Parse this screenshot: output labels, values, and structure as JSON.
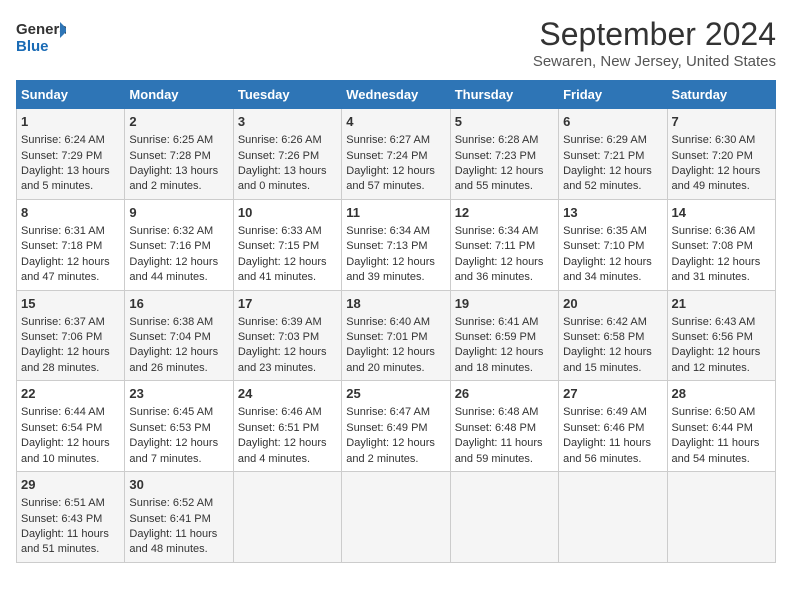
{
  "logo": {
    "line1": "General",
    "line2": "Blue"
  },
  "title": "September 2024",
  "subtitle": "Sewaren, New Jersey, United States",
  "columns": [
    "Sunday",
    "Monday",
    "Tuesday",
    "Wednesday",
    "Thursday",
    "Friday",
    "Saturday"
  ],
  "weeks": [
    [
      {
        "day": "1",
        "lines": [
          "Sunrise: 6:24 AM",
          "Sunset: 7:29 PM",
          "Daylight: 13 hours",
          "and 5 minutes."
        ]
      },
      {
        "day": "2",
        "lines": [
          "Sunrise: 6:25 AM",
          "Sunset: 7:28 PM",
          "Daylight: 13 hours",
          "and 2 minutes."
        ]
      },
      {
        "day": "3",
        "lines": [
          "Sunrise: 6:26 AM",
          "Sunset: 7:26 PM",
          "Daylight: 13 hours",
          "and 0 minutes."
        ]
      },
      {
        "day": "4",
        "lines": [
          "Sunrise: 6:27 AM",
          "Sunset: 7:24 PM",
          "Daylight: 12 hours",
          "and 57 minutes."
        ]
      },
      {
        "day": "5",
        "lines": [
          "Sunrise: 6:28 AM",
          "Sunset: 7:23 PM",
          "Daylight: 12 hours",
          "and 55 minutes."
        ]
      },
      {
        "day": "6",
        "lines": [
          "Sunrise: 6:29 AM",
          "Sunset: 7:21 PM",
          "Daylight: 12 hours",
          "and 52 minutes."
        ]
      },
      {
        "day": "7",
        "lines": [
          "Sunrise: 6:30 AM",
          "Sunset: 7:20 PM",
          "Daylight: 12 hours",
          "and 49 minutes."
        ]
      }
    ],
    [
      {
        "day": "8",
        "lines": [
          "Sunrise: 6:31 AM",
          "Sunset: 7:18 PM",
          "Daylight: 12 hours",
          "and 47 minutes."
        ]
      },
      {
        "day": "9",
        "lines": [
          "Sunrise: 6:32 AM",
          "Sunset: 7:16 PM",
          "Daylight: 12 hours",
          "and 44 minutes."
        ]
      },
      {
        "day": "10",
        "lines": [
          "Sunrise: 6:33 AM",
          "Sunset: 7:15 PM",
          "Daylight: 12 hours",
          "and 41 minutes."
        ]
      },
      {
        "day": "11",
        "lines": [
          "Sunrise: 6:34 AM",
          "Sunset: 7:13 PM",
          "Daylight: 12 hours",
          "and 39 minutes."
        ]
      },
      {
        "day": "12",
        "lines": [
          "Sunrise: 6:34 AM",
          "Sunset: 7:11 PM",
          "Daylight: 12 hours",
          "and 36 minutes."
        ]
      },
      {
        "day": "13",
        "lines": [
          "Sunrise: 6:35 AM",
          "Sunset: 7:10 PM",
          "Daylight: 12 hours",
          "and 34 minutes."
        ]
      },
      {
        "day": "14",
        "lines": [
          "Sunrise: 6:36 AM",
          "Sunset: 7:08 PM",
          "Daylight: 12 hours",
          "and 31 minutes."
        ]
      }
    ],
    [
      {
        "day": "15",
        "lines": [
          "Sunrise: 6:37 AM",
          "Sunset: 7:06 PM",
          "Daylight: 12 hours",
          "and 28 minutes."
        ]
      },
      {
        "day": "16",
        "lines": [
          "Sunrise: 6:38 AM",
          "Sunset: 7:04 PM",
          "Daylight: 12 hours",
          "and 26 minutes."
        ]
      },
      {
        "day": "17",
        "lines": [
          "Sunrise: 6:39 AM",
          "Sunset: 7:03 PM",
          "Daylight: 12 hours",
          "and 23 minutes."
        ]
      },
      {
        "day": "18",
        "lines": [
          "Sunrise: 6:40 AM",
          "Sunset: 7:01 PM",
          "Daylight: 12 hours",
          "and 20 minutes."
        ]
      },
      {
        "day": "19",
        "lines": [
          "Sunrise: 6:41 AM",
          "Sunset: 6:59 PM",
          "Daylight: 12 hours",
          "and 18 minutes."
        ]
      },
      {
        "day": "20",
        "lines": [
          "Sunrise: 6:42 AM",
          "Sunset: 6:58 PM",
          "Daylight: 12 hours",
          "and 15 minutes."
        ]
      },
      {
        "day": "21",
        "lines": [
          "Sunrise: 6:43 AM",
          "Sunset: 6:56 PM",
          "Daylight: 12 hours",
          "and 12 minutes."
        ]
      }
    ],
    [
      {
        "day": "22",
        "lines": [
          "Sunrise: 6:44 AM",
          "Sunset: 6:54 PM",
          "Daylight: 12 hours",
          "and 10 minutes."
        ]
      },
      {
        "day": "23",
        "lines": [
          "Sunrise: 6:45 AM",
          "Sunset: 6:53 PM",
          "Daylight: 12 hours",
          "and 7 minutes."
        ]
      },
      {
        "day": "24",
        "lines": [
          "Sunrise: 6:46 AM",
          "Sunset: 6:51 PM",
          "Daylight: 12 hours",
          "and 4 minutes."
        ]
      },
      {
        "day": "25",
        "lines": [
          "Sunrise: 6:47 AM",
          "Sunset: 6:49 PM",
          "Daylight: 12 hours",
          "and 2 minutes."
        ]
      },
      {
        "day": "26",
        "lines": [
          "Sunrise: 6:48 AM",
          "Sunset: 6:48 PM",
          "Daylight: 11 hours",
          "and 59 minutes."
        ]
      },
      {
        "day": "27",
        "lines": [
          "Sunrise: 6:49 AM",
          "Sunset: 6:46 PM",
          "Daylight: 11 hours",
          "and 56 minutes."
        ]
      },
      {
        "day": "28",
        "lines": [
          "Sunrise: 6:50 AM",
          "Sunset: 6:44 PM",
          "Daylight: 11 hours",
          "and 54 minutes."
        ]
      }
    ],
    [
      {
        "day": "29",
        "lines": [
          "Sunrise: 6:51 AM",
          "Sunset: 6:43 PM",
          "Daylight: 11 hours",
          "and 51 minutes."
        ]
      },
      {
        "day": "30",
        "lines": [
          "Sunrise: 6:52 AM",
          "Sunset: 6:41 PM",
          "Daylight: 11 hours",
          "and 48 minutes."
        ]
      },
      {
        "day": "",
        "lines": []
      },
      {
        "day": "",
        "lines": []
      },
      {
        "day": "",
        "lines": []
      },
      {
        "day": "",
        "lines": []
      },
      {
        "day": "",
        "lines": []
      }
    ]
  ]
}
